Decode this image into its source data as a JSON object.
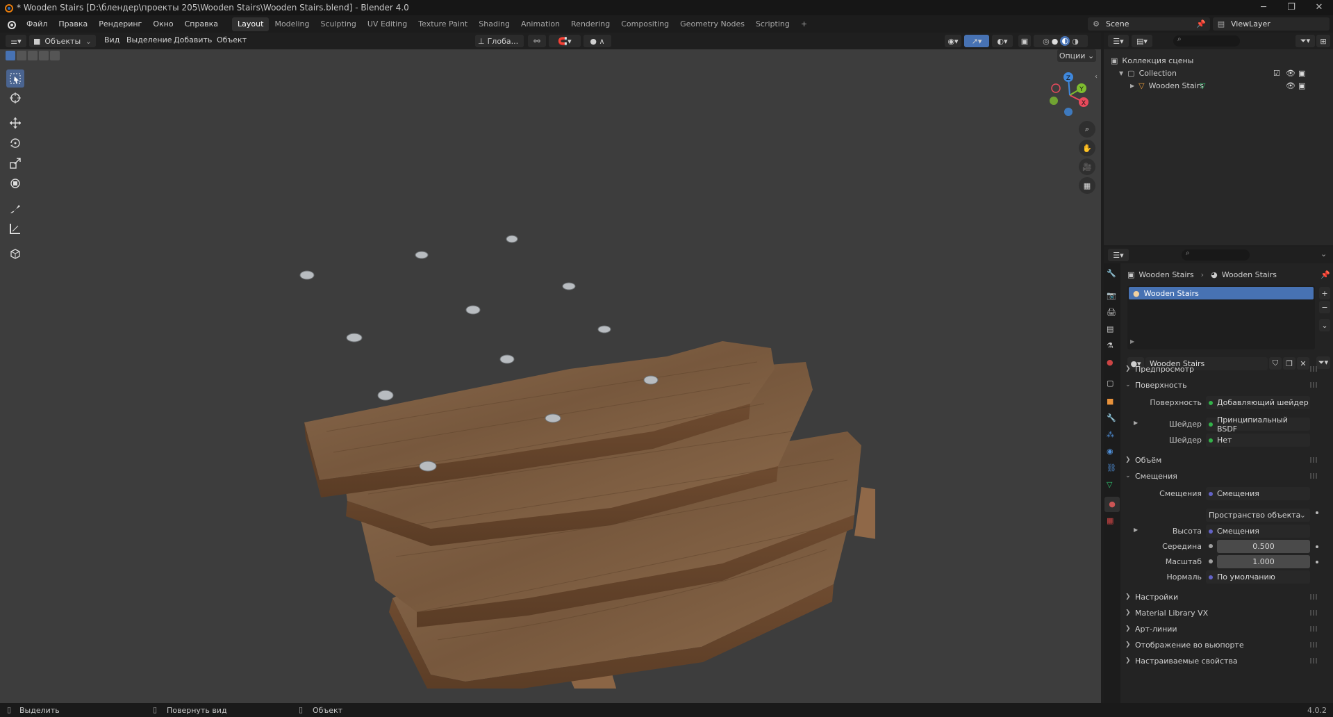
{
  "window": {
    "title": "* Wooden Stairs [D:\\блендер\\проекты 205\\Wooden Stairs\\Wooden Stairs.blend] - Blender 4.0"
  },
  "menu": {
    "items": [
      "Файл",
      "Правка",
      "Рендеринг",
      "Окно",
      "Справка"
    ]
  },
  "workspaces": {
    "tabs": [
      "Layout",
      "Modeling",
      "Sculpting",
      "UV Editing",
      "Texture Paint",
      "Shading",
      "Animation",
      "Rendering",
      "Compositing",
      "Geometry Nodes",
      "Scripting"
    ],
    "active": "Layout",
    "add": "+"
  },
  "scene": {
    "name": "Scene",
    "view_layer": "ViewLayer"
  },
  "viewport_header": {
    "mode": "Объекты",
    "menus": [
      "Вид",
      "Выделение",
      "Добавить",
      "Объект"
    ],
    "transform_orientation": "Глоба...",
    "options": "Опции"
  },
  "gizmo": {
    "axes": [
      "X",
      "Y",
      "Z"
    ]
  },
  "outliner": {
    "root": "Коллекция сцены",
    "collection": "Collection",
    "object": "Wooden Stairs"
  },
  "properties": {
    "breadcrumb": [
      "Wooden Stairs",
      "Wooden Stairs"
    ],
    "material_slot": "Wooden Stairs",
    "material_name": "Wooden Stairs",
    "sections": {
      "preview": "Предпросмотр",
      "surface": "Поверхность",
      "volume": "Объём",
      "displacement": "Смещения",
      "settings": "Настройки",
      "material_library": "Material Library VX",
      "lineart": "Арт-линии",
      "viewport_display": "Отображение во вьюпорте",
      "custom_props": "Настраиваемые свойства"
    },
    "surface_rows": [
      {
        "label": "Поверхность",
        "value": "Добавляющий шейдер",
        "color": "#33b24a"
      },
      {
        "label": "Шейдер",
        "value": "Принципиальный BSDF",
        "color": "#33b24a"
      },
      {
        "label": "Шейдер",
        "value": "Нет",
        "color": "#33b24a"
      }
    ],
    "displacement_rows": {
      "displacement": {
        "label": "Смещения",
        "value": "Смещения",
        "color": "#6363c7"
      },
      "space": "Пространство объекта",
      "height": {
        "label": "Высота",
        "value": "Смещения",
        "color": "#6363c7"
      },
      "midlevel": {
        "label": "Середина",
        "value": "0.500",
        "color": "#a1a1a1"
      },
      "scale": {
        "label": "Масштаб",
        "value": "1.000",
        "color": "#a1a1a1"
      },
      "normal": {
        "label": "Нормаль",
        "value": "По умолчанию",
        "color": "#6363c7"
      }
    }
  },
  "status": {
    "select": "Выделить",
    "rotate": "Повернуть вид",
    "object": "Объект",
    "version": "4.0.2"
  },
  "colors": {
    "accent": "#4772b3",
    "active_tool": "#4a6490",
    "viewport_bg": "#3d3d3d"
  }
}
